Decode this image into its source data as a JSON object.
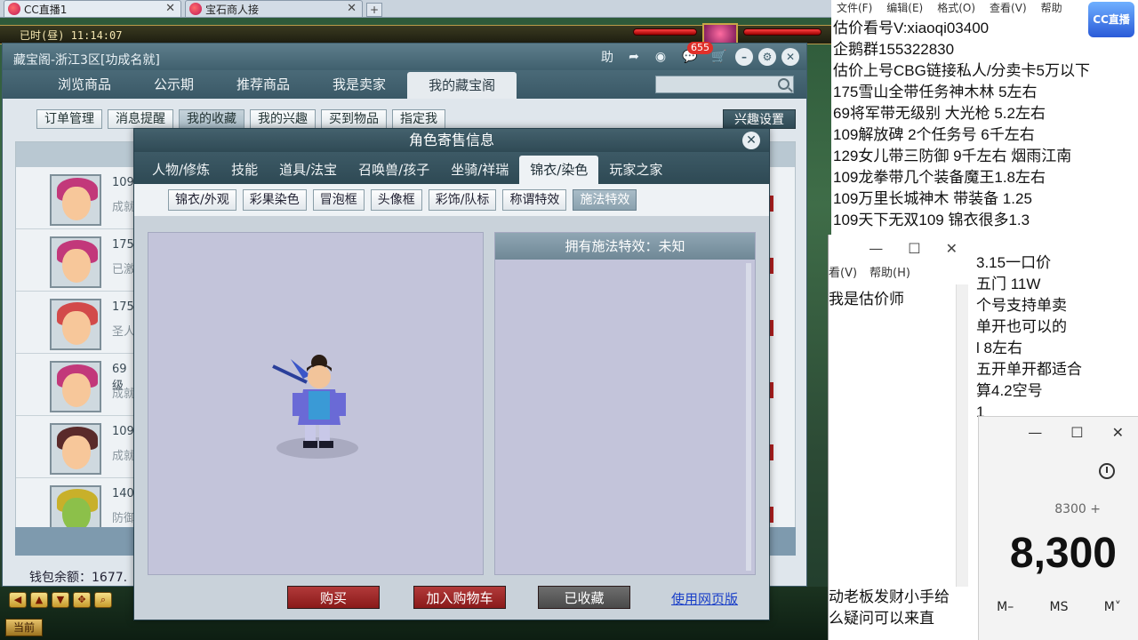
{
  "browser_tabs": [
    {
      "label": "CC直播1",
      "active": true
    },
    {
      "label": "宝石商人接",
      "active": false
    }
  ],
  "game": {
    "clock": "已时(昼)  11:14:07",
    "current_label": "当前"
  },
  "cbg": {
    "title": "藏宝阁-浙江3区[功成名就]",
    "help_label": "助",
    "message_badge": "655",
    "nav": [
      "浏览商品",
      "公示期",
      "推荐商品",
      "我是卖家",
      "我的藏宝阁"
    ],
    "subnav": [
      "订单管理",
      "消息提醒",
      "我的收藏",
      "我的兴趣",
      "买到物品",
      "指定我"
    ],
    "interest_button": "兴趣设置",
    "rows": [
      {
        "line1": "109",
        "line2": "成就"
      },
      {
        "line1": "175",
        "line2": "已激"
      },
      {
        "line1": "175",
        "line2": "圣人"
      },
      {
        "line1": "69级",
        "line2": "成就"
      },
      {
        "line1": "109",
        "line2": "成就"
      },
      {
        "line1": "140",
        "line2": "防御"
      }
    ],
    "wallet": "钱包余额：1677."
  },
  "modal": {
    "title": "角色寄售信息",
    "tabs": [
      "人物/修炼",
      "技能",
      "道具/法宝",
      "召唤兽/孩子",
      "坐骑/祥瑞",
      "锦衣/染色",
      "玩家之家"
    ],
    "subtabs": [
      "锦衣/外观",
      "彩果染色",
      "冒泡框",
      "头像框",
      "彩饰/队标",
      "称谓特效",
      "施法特效"
    ],
    "effect_header": "拥有施法特效：未知",
    "buttons": {
      "buy": "购买",
      "add_cart": "加入购物车",
      "collected": "已收藏",
      "web": "使用网页版"
    }
  },
  "notepad": {
    "menu": [
      "文件(F)",
      "编辑(E)",
      "格式(O)",
      "查看(V)",
      "帮助"
    ],
    "logo": "CC直播",
    "lines": [
      "估价看号V:xiaoqi03400",
      "企鹅群155322830",
      "估价上号CBG链接私人/分卖卡5万以下",
      "175雪山全带任务神木林 5左右",
      "69将军带无级别 大光枪 5.2左右",
      "109解放碑 2个任务号 6千左右",
      "129女儿带三防御 9千左右 烟雨江南",
      "109龙拳带几个装备魔王1.8左右",
      "109万里长城神木 带装备  1.25",
      "109天下无双109  锦衣很多1.3"
    ],
    "lines2": [
      "3.15一口价",
      "五门 11W",
      "个号支持单卖",
      "单开也可以的",
      "l  8左右",
      "五开单开都适合",
      "算4.2空号",
      "1"
    ]
  },
  "notepad2": {
    "menu": [
      "看(V)",
      "帮助(H)"
    ],
    "line": "我是估价师",
    "bottom": [
      "动老板发财小手给",
      "么疑问可以来直"
    ]
  },
  "calculator": {
    "expression": "8300 +",
    "result": "8,300",
    "memory": [
      "M–",
      "MS",
      "M˅"
    ]
  }
}
